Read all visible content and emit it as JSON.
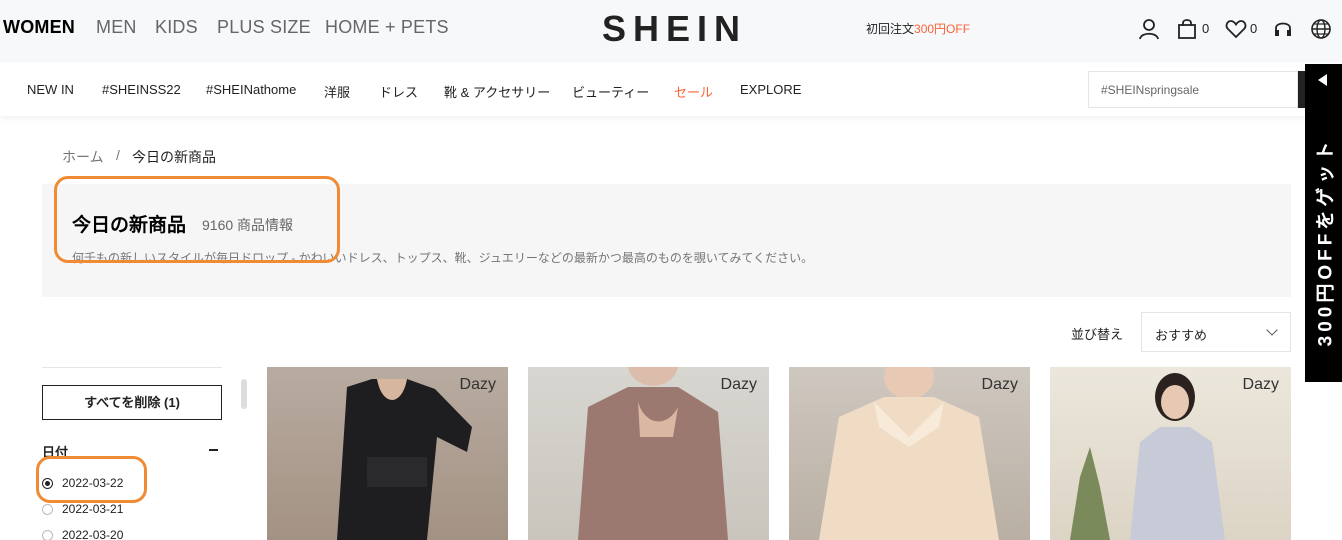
{
  "top_categories": [
    "WOMEN",
    "MEN",
    "KIDS",
    "PLUS SIZE",
    "HOME + PETS"
  ],
  "logo": "SHEIN",
  "promo": {
    "prefix": "初回注文",
    "highlight": "300円OFF"
  },
  "header_counts": {
    "cart": "0",
    "wishlist": "0"
  },
  "nav_items": [
    "NEW IN",
    "#SHEINSS22",
    "#SHEINathome",
    "洋服",
    "ドレス",
    "靴 & アクセサリー",
    "ビューティー",
    "セール",
    "EXPLORE"
  ],
  "search": {
    "placeholder": "#SHEINspringsale"
  },
  "side_promo": "300円OFFをゲット",
  "breadcrumb": {
    "home": "ホーム",
    "separator": "/",
    "current": "今日の新商品"
  },
  "page": {
    "title": "今日の新商品",
    "count": "9160 商品情報",
    "description": "何千もの新しいスタイルが毎日ドロップ - かわいいドレス、トップス、靴、ジュエリーなどの最新かつ最高のものを覗いてみてください。"
  },
  "sort": {
    "label": "並び替え",
    "value": "おすすめ"
  },
  "filters": {
    "clear_label": "すべてを削除 (1)",
    "date_heading": "日付",
    "date_options": [
      {
        "label": "2022-03-22",
        "selected": true
      },
      {
        "label": "2022-03-21",
        "selected": false
      },
      {
        "label": "2022-03-20",
        "selected": false
      }
    ]
  },
  "products": [
    {
      "brand": "Dazy"
    },
    {
      "brand": "Dazy"
    },
    {
      "brand": "Dazy"
    },
    {
      "brand": "Dazy"
    }
  ],
  "colors": {
    "accent": "#fa6338",
    "highlight": "#f08a33",
    "dark": "#222222"
  }
}
